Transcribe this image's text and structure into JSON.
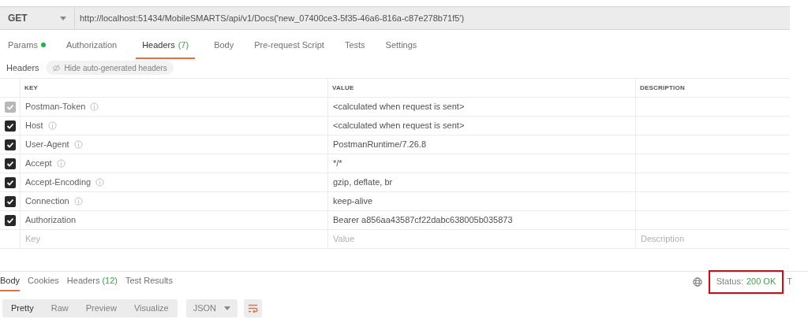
{
  "request": {
    "method": "GET",
    "url": "http://localhost:51434/MobileSMARTS/api/v1/Docs('new_07400ce3-5f35-46a6-816a-c87e278b71f5')"
  },
  "request_tabs": [
    {
      "label": "Params",
      "dot": true,
      "selected": false
    },
    {
      "label": "Authorization",
      "dot": false,
      "selected": false
    },
    {
      "label": "Headers",
      "count": "(7)",
      "dot": false,
      "selected": true
    },
    {
      "label": "Body",
      "dot": false,
      "selected": false
    },
    {
      "label": "Pre-request Script",
      "dot": false,
      "selected": false
    },
    {
      "label": "Tests",
      "dot": false,
      "selected": false
    },
    {
      "label": "Settings",
      "dot": false,
      "selected": false
    }
  ],
  "headers_bar": {
    "label": "Headers",
    "toggle": "Hide auto-generated headers"
  },
  "table": {
    "columns": [
      "KEY",
      "VALUE",
      "DESCRIPTION"
    ],
    "rows": [
      {
        "key": "Postman-Token",
        "value": "<calculated when request is sent>",
        "checked": true,
        "disabled": true,
        "info": true
      },
      {
        "key": "Host",
        "value": "<calculated when request is sent>",
        "checked": true,
        "disabled": false,
        "info": true
      },
      {
        "key": "User-Agent",
        "value": "PostmanRuntime/7.26.8",
        "checked": true,
        "disabled": false,
        "info": true
      },
      {
        "key": "Accept",
        "value": "*/*",
        "checked": true,
        "disabled": false,
        "info": true
      },
      {
        "key": "Accept-Encoding",
        "value": "gzip, deflate, br",
        "checked": true,
        "disabled": false,
        "info": true
      },
      {
        "key": "Connection",
        "value": "keep-alive",
        "checked": true,
        "disabled": false,
        "info": true
      },
      {
        "key": "Authorization",
        "value": "Bearer a856aa43587cf22dabc638005b035873",
        "checked": true,
        "disabled": false,
        "info": false
      }
    ],
    "new_row": {
      "key_placeholder": "Key",
      "value_placeholder": "Value",
      "description_placeholder": "Description"
    }
  },
  "response_tabs": [
    {
      "label": "Body",
      "selected": true
    },
    {
      "label": "Cookies",
      "selected": false
    },
    {
      "label": "Headers",
      "count": "(12)",
      "selected": false
    },
    {
      "label": "Test Results",
      "selected": false
    }
  ],
  "status": {
    "label": "Status:",
    "value": "200 OK",
    "highlighted": true,
    "next": "T"
  },
  "view_modes": [
    {
      "label": "Pretty",
      "selected": true
    },
    {
      "label": "Raw",
      "selected": false
    },
    {
      "label": "Preview",
      "selected": false
    },
    {
      "label": "Visualize",
      "selected": false
    }
  ],
  "format": "JSON"
}
